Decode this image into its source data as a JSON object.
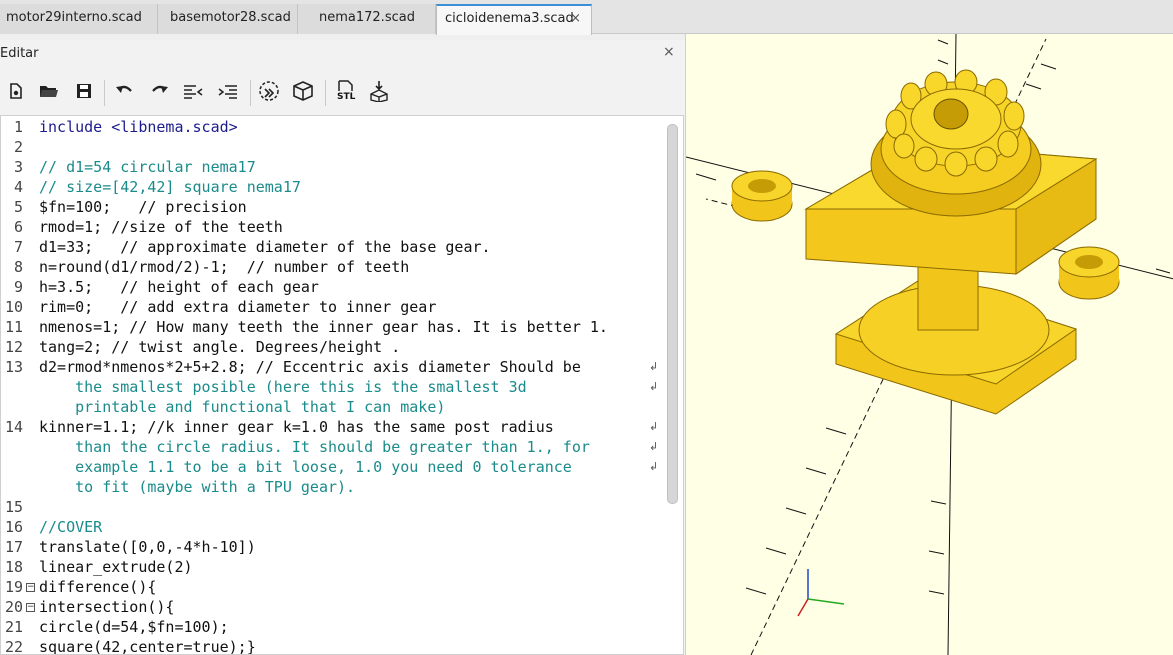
{
  "tabs": [
    {
      "label": "motor29interno.scad"
    },
    {
      "label": "basemotor28.scad"
    },
    {
      "label": "nema172.scad"
    },
    {
      "label": "cicloidenema3.scad",
      "close": "×"
    }
  ],
  "editor": {
    "title": "Editar",
    "close": "×",
    "toolbar_icons": [
      "new-file-icon",
      "open-file-icon",
      "save-icon",
      "undo-icon",
      "redo-icon",
      "unindent-icon",
      "indent-icon",
      "preview-icon",
      "render-icon",
      "export-stl-icon",
      "send-to-print-icon"
    ],
    "stl_label": "STL",
    "line_numbers": [
      "1",
      "2",
      "3",
      "4",
      "5",
      "6",
      "7",
      "8",
      "9",
      "10",
      "11",
      "12",
      "13",
      "",
      "",
      "14",
      "",
      "",
      "",
      "15",
      "16",
      "17",
      "18",
      "19",
      "20",
      "21",
      "22"
    ],
    "lines": [
      "include <libnema.scad>",
      "",
      "// d1=54 circular nema17",
      "// size=[42,42] square nema17",
      "$fn=100;   // precision",
      "rmod=1; //size of the teeth",
      "d1=33;   // approximate diameter of the base gear.",
      "n=round(d1/rmod/2)-1;  // number of teeth",
      "h=3.5;   // height of each gear",
      "rim=0;   // add extra diameter to inner gear",
      "nmenos=1; // How many teeth the inner gear has. It is better 1.",
      "tang=2; // twist angle. Degrees/height .",
      "d2=rmod*nmenos*2+5+2.8; // Eccentric axis diameter Should be",
      "    the smallest posible (here this is the smallest 3d",
      "    printable and functional that I can make)",
      "kinner=1.1; //k inner gear k=1.0 has the same post radius",
      "    than the circle radius. It should be greater than 1., for",
      "    example 1.1 to be a bit loose, 1.0 you need 0 tolerance",
      "    to fit (maybe with a TPU gear).",
      "",
      "//COVER",
      "translate([0,0,-4*h-10])",
      "linear_extrude(2)",
      "difference(){",
      "intersection(){",
      "circle(d=54,$fn=100);",
      "square(42,center=true);}"
    ]
  },
  "colors": {
    "accent": "#3b8fd6",
    "model_yellow": "#f7d21c",
    "viewport_bg": "#ffffe5",
    "comment": "#1b8b8b",
    "number": "#c01818",
    "keyword": "#1c1c8c"
  }
}
